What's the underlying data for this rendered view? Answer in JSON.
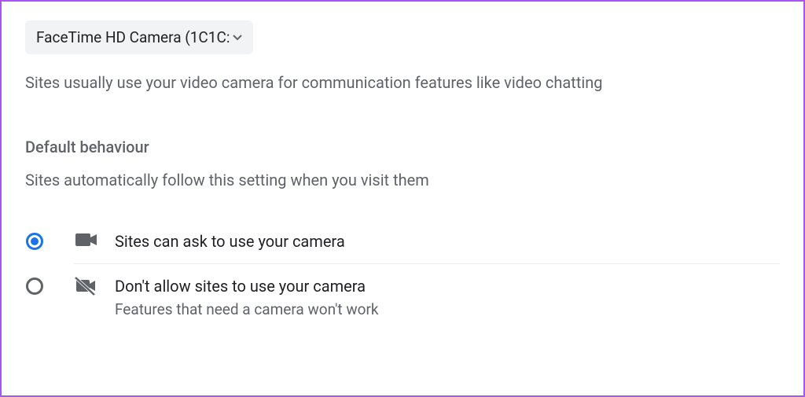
{
  "camera_select": {
    "value": "FaceTime HD Camera (1C1C:"
  },
  "description": "Sites usually use your video camera for communication features like video chatting",
  "section": {
    "heading": "Default behaviour",
    "sub": "Sites automatically follow this setting when you visit them"
  },
  "options": {
    "allow": {
      "title": "Sites can ask to use your camera",
      "selected": true
    },
    "block": {
      "title": "Don't allow sites to use your camera",
      "sub": "Features that need a camera won't work",
      "selected": false
    }
  }
}
